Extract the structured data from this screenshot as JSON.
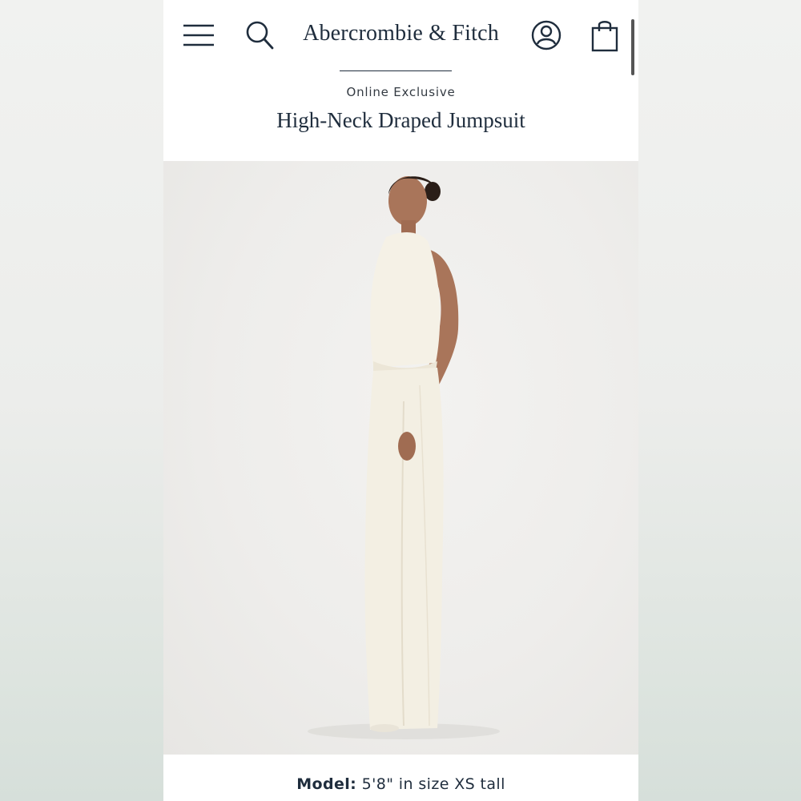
{
  "header": {
    "brand": "Abercrombie & Fitch",
    "icons": {
      "menu": "hamburger-menu-icon",
      "search": "search-icon",
      "account": "account-icon",
      "bag": "shopping-bag-icon"
    }
  },
  "product": {
    "eyebrow": "Online Exclusive",
    "title": "High-Neck Draped Jumpsuit"
  },
  "model_info": {
    "label": "Model:",
    "value": "5'8\" in size XS tall"
  },
  "colors": {
    "brand_text": "#1f2d3d",
    "background": "#ffffff"
  }
}
